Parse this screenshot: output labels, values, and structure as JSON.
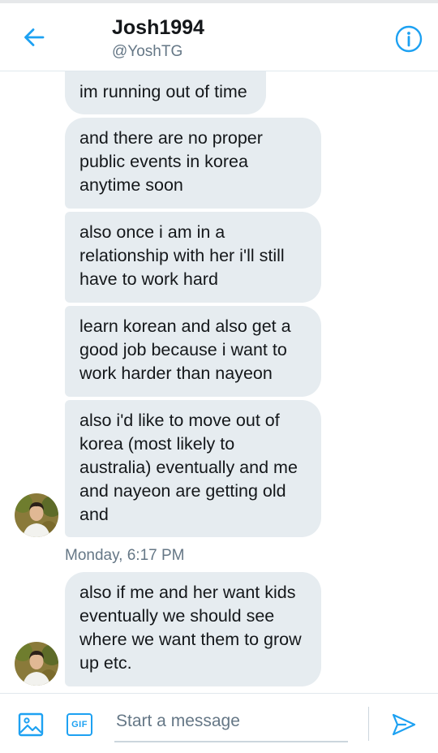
{
  "header": {
    "name": "Josh1994",
    "handle": "@YoshTG",
    "back_icon": "arrow-left-icon",
    "info_icon": "info-circle-icon"
  },
  "messages": [
    {
      "text": "im running out of time"
    },
    {
      "text": "and there are no proper public events in korea anytime soon"
    },
    {
      "text": "also once i am in a relationship with her i'll still have to work hard"
    },
    {
      "text": "learn korean and also get a good job because i want to work harder than nayeon"
    },
    {
      "text": "also i'd like to move out of korea (most likely to australia) eventually and me and nayeon are getting old and"
    },
    {
      "text": "also if me and her want kids eventually we should see where we want them to grow up etc."
    }
  ],
  "timestamp": "Monday, 6:17 PM",
  "composer": {
    "placeholder": "Start a message",
    "value": "",
    "gif_label": "GIF",
    "media_icon": "image-icon",
    "send_icon": "send-icon"
  },
  "colors": {
    "accent": "#1da1f2",
    "bubble": "#e6ecf0",
    "secondary_text": "#657786"
  }
}
